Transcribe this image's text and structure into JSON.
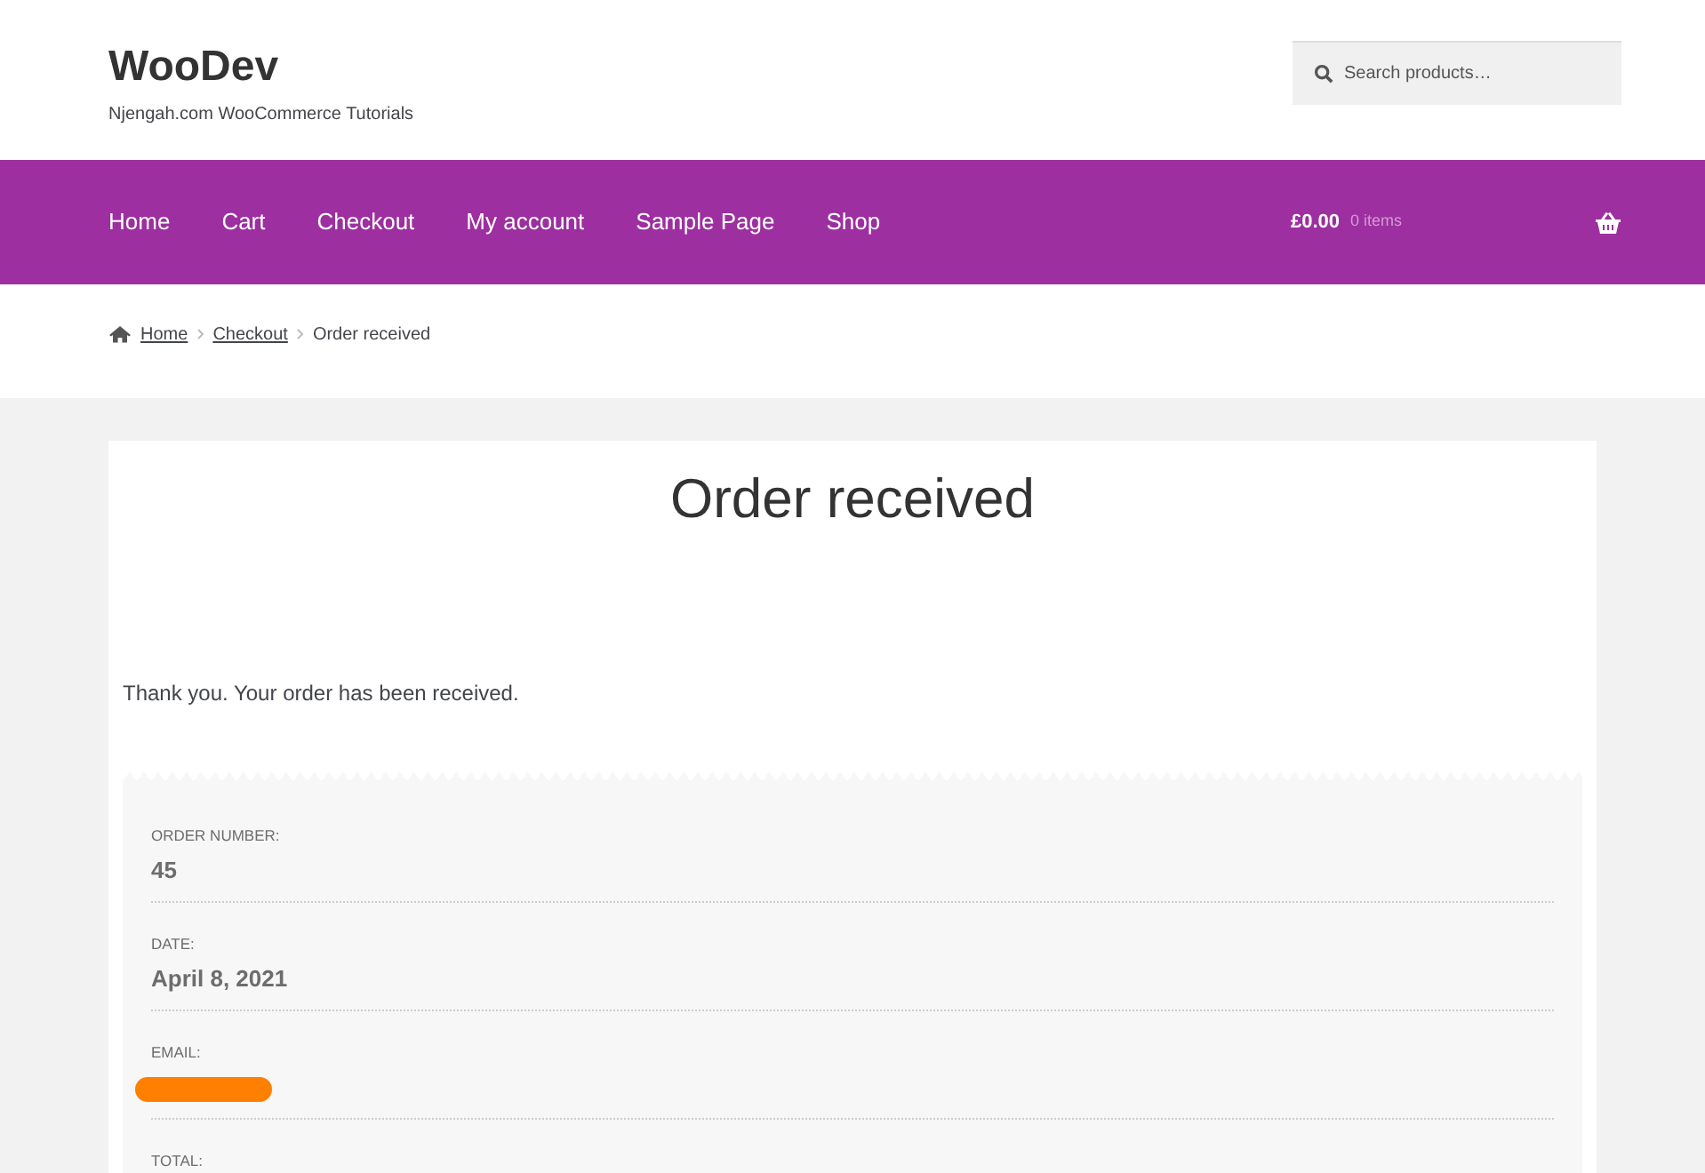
{
  "site": {
    "title": "WooDev",
    "tagline": "Njengah.com WooCommerce Tutorials"
  },
  "search": {
    "placeholder": "Search products…"
  },
  "nav": {
    "items": [
      {
        "label": "Home"
      },
      {
        "label": "Cart"
      },
      {
        "label": "Checkout"
      },
      {
        "label": "My account"
      },
      {
        "label": "Sample Page"
      },
      {
        "label": "Shop"
      }
    ],
    "cart": {
      "amount": "£0.00",
      "count": "0 items"
    }
  },
  "breadcrumb": {
    "links": [
      "Home",
      "Checkout"
    ],
    "current": "Order received"
  },
  "page": {
    "title": "Order received",
    "message": "Thank you. Your order has been received."
  },
  "order_details": [
    {
      "kind": "text",
      "label": "ORDER NUMBER:",
      "value": "45"
    },
    {
      "kind": "text",
      "label": "DATE:",
      "value": "April 8, 2021"
    },
    {
      "kind": "redacted",
      "label": "EMAIL:"
    },
    {
      "kind": "label_only",
      "label": "TOTAL:"
    }
  ]
}
